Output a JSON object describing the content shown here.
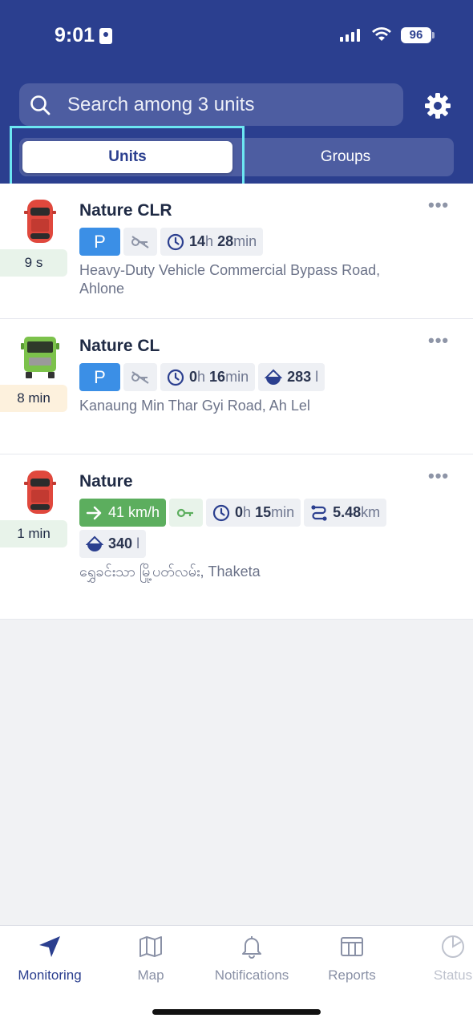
{
  "status_bar": {
    "time": "9:01",
    "battery": "96"
  },
  "search": {
    "placeholder": "Search among 3 units"
  },
  "tabs": {
    "units": "Units",
    "groups": "Groups"
  },
  "units": [
    {
      "name": "Nature CLR",
      "ago": "9 s",
      "parking": "P",
      "duration_h": "14",
      "h": "h",
      "duration_m": "28",
      "min": "min",
      "address": "Heavy-Duty Vehicle Commercial Bypass Road, Ahlone"
    },
    {
      "name": "Nature CL",
      "ago": "8 min",
      "parking": "P",
      "duration_h": "0",
      "h": "h",
      "duration_m": "16",
      "min": "min",
      "fuel": "283",
      "fuel_unit": "l",
      "address": "Kanaung Min Thar Gyi Road, Ah Lel"
    },
    {
      "name": "Nature",
      "ago": "1 min",
      "speed": "41 km/h",
      "duration_h": "0",
      "h": "h",
      "duration_m": "15",
      "min": "min",
      "mileage": "5.48",
      "mileage_unit": "km",
      "fuel": "340",
      "fuel_unit": "l",
      "address": "ရွှေခင်းသာ မြို့ပတ်လမ်း, Thaketa"
    }
  ],
  "nav": [
    {
      "label": "Monitoring",
      "icon": "navigation-arrow-icon"
    },
    {
      "label": "Map",
      "icon": "map-icon"
    },
    {
      "label": "Notifications",
      "icon": "bell-icon"
    },
    {
      "label": "Reports",
      "icon": "reports-icon"
    },
    {
      "label": "Status",
      "icon": "status-icon"
    }
  ],
  "colors": {
    "header": "#2b3f8f",
    "accent": "#2b3f8f",
    "parking": "#3b8fe6",
    "moving": "#5cae5e",
    "highlight": "#6ce7f2"
  }
}
